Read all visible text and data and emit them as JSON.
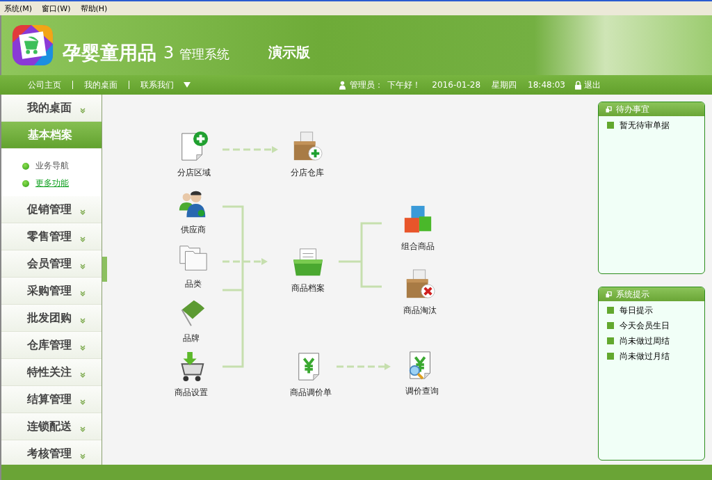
{
  "menu_bar": [
    {
      "label": "系统(M)"
    },
    {
      "label": "窗口(W)"
    },
    {
      "label": "帮助(H)"
    }
  ],
  "header": {
    "title": "孕婴童用品",
    "version": "3",
    "subtitle": "管理系统",
    "edition": "演示版"
  },
  "nav": {
    "links": [
      "公司主页",
      "我的桌面",
      "联系我们"
    ],
    "user_label": "管理员：",
    "greeting": "下午好！",
    "date": "2016-01-28",
    "weekday": "星期四",
    "time": "18:48:03",
    "logout": "退出"
  },
  "sidebar": {
    "items": [
      {
        "label": "我的桌面",
        "selected": false,
        "expanded": false
      },
      {
        "label": "基本档案",
        "selected": true,
        "expanded": true,
        "children": [
          {
            "label": "业务导航",
            "selected": false
          },
          {
            "label": "更多功能",
            "selected": true
          }
        ]
      },
      {
        "label": "促销管理",
        "selected": false,
        "expanded": false
      },
      {
        "label": "零售管理",
        "selected": false,
        "expanded": false
      },
      {
        "label": "会员管理",
        "selected": false,
        "expanded": false
      },
      {
        "label": "采购管理",
        "selected": false,
        "expanded": false
      },
      {
        "label": "批发团购",
        "selected": false,
        "expanded": false
      },
      {
        "label": "仓库管理",
        "selected": false,
        "expanded": false
      },
      {
        "label": "特性关注",
        "selected": false,
        "expanded": false
      },
      {
        "label": "结算管理",
        "selected": false,
        "expanded": false
      },
      {
        "label": "连锁配送",
        "selected": false,
        "expanded": false
      },
      {
        "label": "考核管理",
        "selected": false,
        "expanded": false
      }
    ]
  },
  "flow": {
    "nodes": [
      {
        "label": "分店区域",
        "kind": "doc-plus"
      },
      {
        "label": "分店仓库",
        "kind": "box-plus"
      },
      {
        "label": "供应商",
        "kind": "people"
      },
      {
        "label": "品类",
        "kind": "folders"
      },
      {
        "label": "商品档案",
        "kind": "tray"
      },
      {
        "label": "组合商品",
        "kind": "cubes"
      },
      {
        "label": "商品淘汰",
        "kind": "box-x"
      },
      {
        "label": "品牌",
        "kind": "flag"
      },
      {
        "label": "商品设置",
        "kind": "cart"
      },
      {
        "label": "商品调价单",
        "kind": "yen-doc"
      },
      {
        "label": "调价查询",
        "kind": "yen-search"
      }
    ]
  },
  "panels": [
    {
      "title": "待办事宜",
      "items": [
        "暂无待审单据"
      ]
    },
    {
      "title": "系统提示",
      "items": [
        "每日提示",
        "今天会员生日",
        "尚未做过周结",
        "尚未做过月结"
      ]
    }
  ]
}
